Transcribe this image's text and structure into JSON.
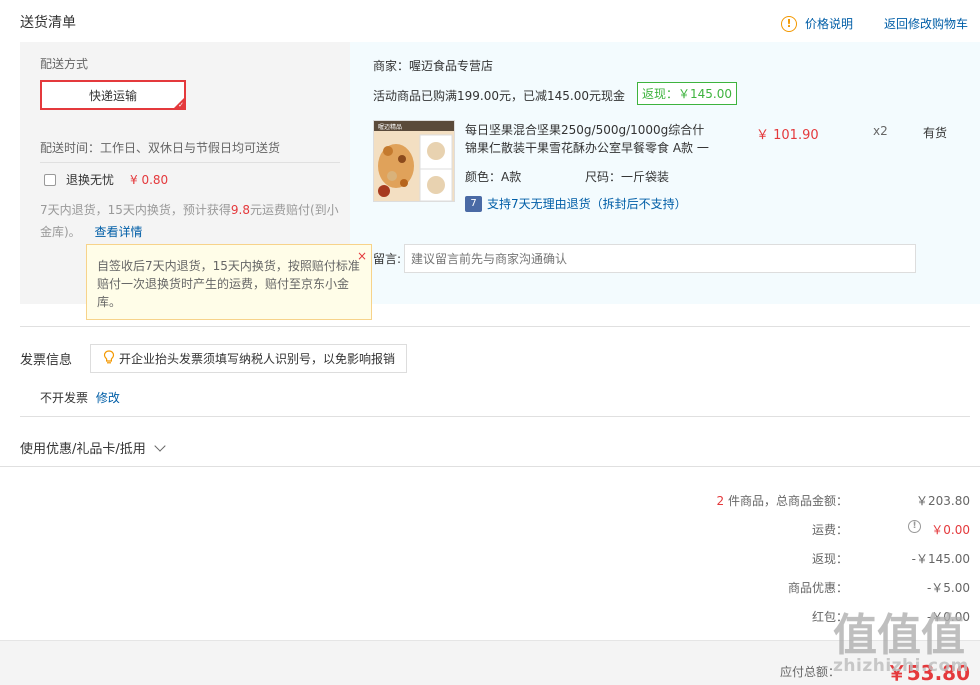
{
  "header": {
    "title": "送货清单",
    "price_note": "价格说明",
    "back_to_cart": "返回修改购物车"
  },
  "shipping": {
    "label": "配送方式",
    "method": "快递运输",
    "time": "配送时间：工作日、双休日与节假日均可送货",
    "return_option_label": "退换无忧",
    "return_option_price": "¥ 0.80",
    "return_note_prefix": "7天内退货，15天内换货，预计获得",
    "return_note_amount": "9.8",
    "return_note_suffix": "元运费赔付(到小金库)。",
    "details_link": "查看详情"
  },
  "tooltip": {
    "text": "自签收后7天内退货，15天内换货，按照赔付标准赔付一次退换货时产生的运费，赔付至京东小金库。",
    "close": "×"
  },
  "shop": {
    "merchant": "商家：喔迈食品专营店",
    "promo": "活动商品已购满199.00元，已减145.00元现金",
    "rebate": "返现：￥145.00"
  },
  "product": {
    "image_text": "喔迈精品",
    "name": "每日坚果混合坚果250g/500g/1000g综合什锦果仁散装干果雪花酥办公室早餐零食 A款 一",
    "price": "￥ 101.90",
    "qty": "x2",
    "stock": "有货",
    "color": "颜色：A款",
    "size": "尺码：一斤袋装",
    "return_policy": "支持7天无理由退货（拆封后不支持）",
    "return_icon": "7"
  },
  "message": {
    "label": "留言:",
    "placeholder": "建议留言前先与商家沟通确认"
  },
  "invoice": {
    "title": "发票信息",
    "tip": "开企业抬头发票须填写纳税人识别号，以免影响报销",
    "value": "不开发票",
    "edit": "修改"
  },
  "coupon": {
    "label": "使用优惠/礼品卡/抵用"
  },
  "summary": {
    "items_count": "2",
    "items_label": "件商品，总商品金额：",
    "items_total": "￥203.80",
    "shipping_label": "运费：",
    "shipping_value": "￥0.00",
    "rebate_label": "返现：",
    "rebate_value": "-￥145.00",
    "discount_label": "商品优惠：",
    "discount_value": "-￥5.00",
    "redpacket_label": "红包：",
    "redpacket_value": "-￥0.00",
    "total_label": "应付总额：",
    "total_value": "￥53.80"
  },
  "watermark": {
    "text": "zhizhizhi.com",
    "logo_text": "值值值"
  },
  "colors": {
    "accent_red": "#e4393c",
    "link_blue": "#005ea7",
    "rebate_green": "#3eb33e",
    "warning_orange": "#f39800"
  }
}
